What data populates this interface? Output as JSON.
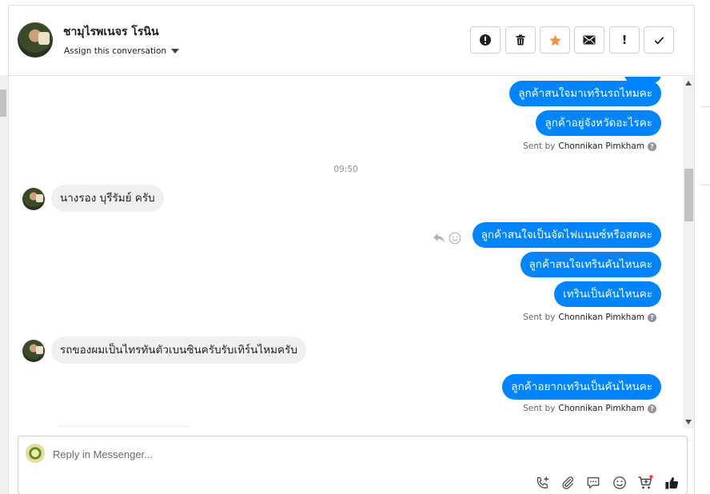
{
  "header": {
    "contact_name": "ชามุไรพเนจร โรนิน",
    "assign_label": "Assign this conversation"
  },
  "header_actions": [
    {
      "name": "mark-spam-button",
      "icon": "exclamation-circle-icon"
    },
    {
      "name": "delete-button",
      "icon": "trash-icon"
    },
    {
      "name": "star-button",
      "icon": "star-icon",
      "color": "#f5923e"
    },
    {
      "name": "mark-unread-button",
      "icon": "envelope-icon"
    },
    {
      "name": "follow-up-button",
      "icon": "exclamation-icon",
      "label": "!"
    },
    {
      "name": "mark-done-button",
      "icon": "checkmark-icon"
    }
  ],
  "messages": {
    "out_1": "ลูกค้าสนใจมาเทรินรถไหมคะ",
    "out_2": "ลูกค้าอยู่จังหวัดอะไรคะ",
    "sent_by_1_prefix": "Sent by",
    "sent_by_1_name": "Chonnikan Pimkham",
    "timestamp": "09:50",
    "in_1": "นางรอง บุรีรัมย์ ครับ",
    "out_3": "ลูกค้าสนใจเป็นจัดไฟแนนซ์หรือสดคะ",
    "out_4": "ลูกค้าสนใจเทรินคันไหนคะ",
    "out_5": "เทรินเป็นคันไหนคะ",
    "sent_by_2_prefix": "Sent by",
    "sent_by_2_name": "Chonnikan Pimkham",
    "in_2": "รถของผมเป็นไทรทันตัวเบนซินครับรับเทิร์นไหมครับ",
    "out_6": "ลูกค้าอยากเทรินเป็นคันไหนคะ",
    "sent_by_3_prefix": "Sent by",
    "sent_by_3_name": "Chonnikan Pimkham"
  },
  "composer": {
    "placeholder": "Reply in Messenger...",
    "tools": [
      "phone-add-icon",
      "paperclip-icon",
      "saved-reply-icon",
      "emoji-icon",
      "cart-add-icon",
      "thumbs-up-icon"
    ]
  },
  "colors": {
    "outgoing_bubble": "#0084ff",
    "incoming_bubble": "#f1f0f0",
    "star": "#f5923e",
    "notification_dot": "#fa3e3e"
  }
}
